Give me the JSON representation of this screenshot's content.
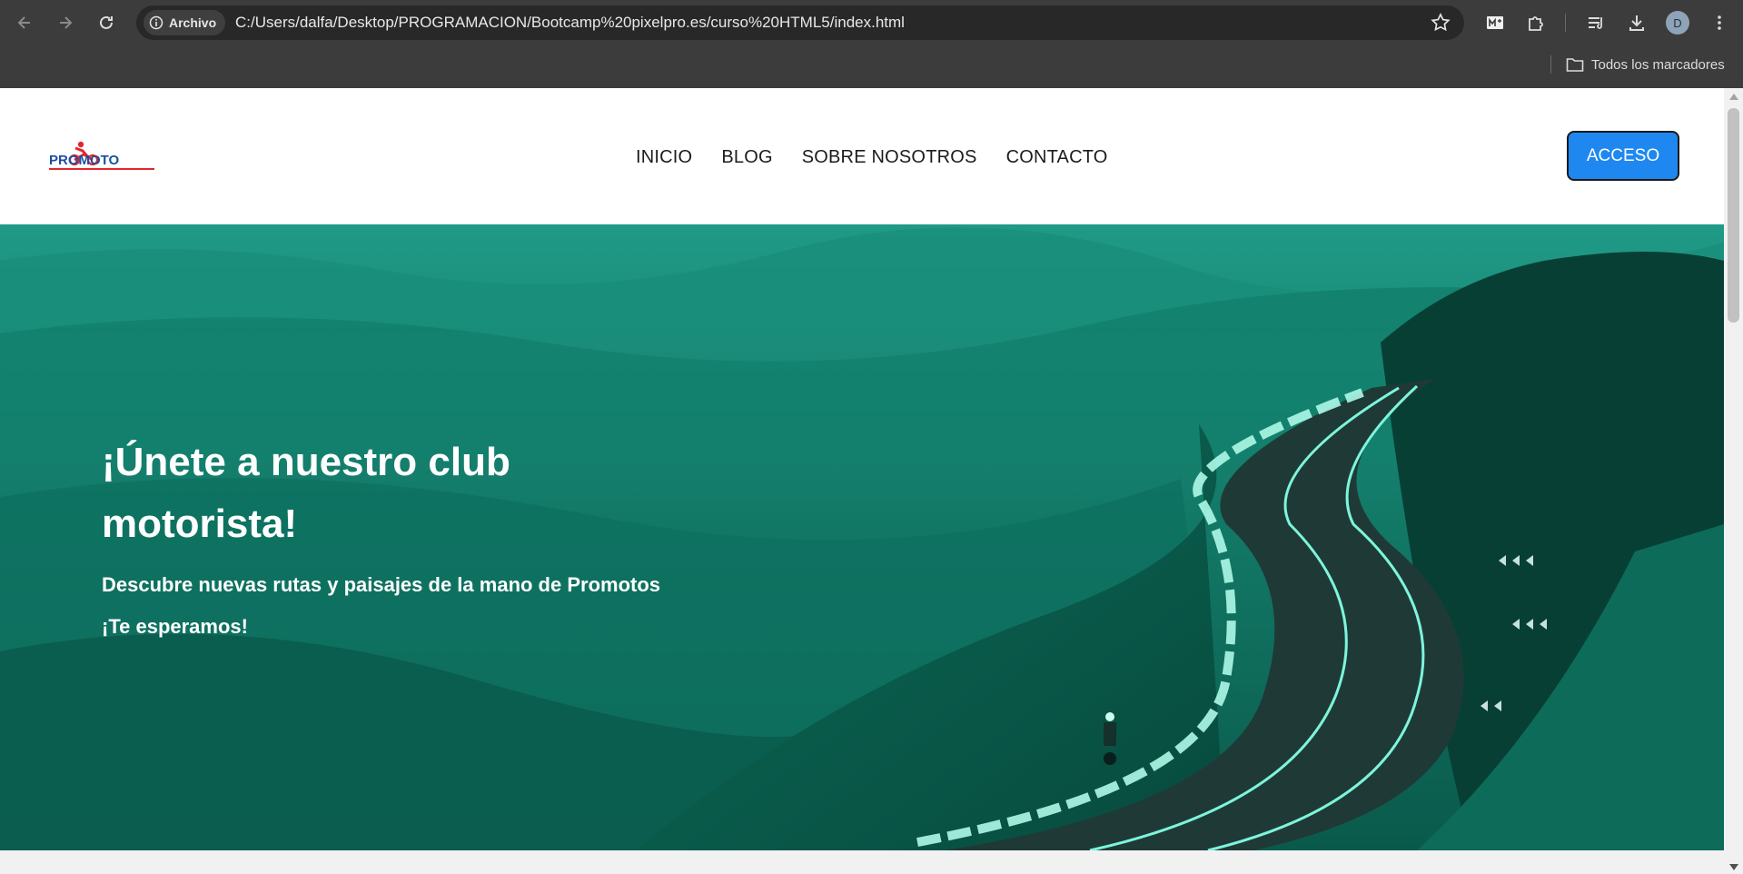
{
  "browser": {
    "site_chip_label": "Archivo",
    "url": "C:/Users/dalfa/Desktop/PROGRAMACION/Bootcamp%20pixelpro.es/curso%20HTML5/index.html",
    "avatar_initial": "D",
    "bookmarks_folder_label": "Todos los marcadores",
    "icons": [
      "back-arrow-icon",
      "forward-arrow-icon",
      "reload-icon",
      "info-icon",
      "star-icon",
      "media-icon",
      "extensions-icon",
      "reading-list-icon",
      "download-icon",
      "menu-kebab-icon",
      "folder-icon"
    ]
  },
  "site": {
    "logo_text": "PROMOTO",
    "nav": [
      {
        "label": "INICIO"
      },
      {
        "label": "BLOG"
      },
      {
        "label": "SOBRE NOSOTROS"
      },
      {
        "label": "CONTACTO"
      }
    ],
    "access_button": "ACCESO",
    "hero": {
      "title": "¡Únete a nuestro club motorista!",
      "subtitle": "Descubre nuevas rutas y paisajes de la mano de Promotos",
      "cta_text": "¡Te esperamos!"
    }
  },
  "colors": {
    "chrome_bg": "#3c3c3c",
    "omnibox_bg": "#282828",
    "access_button_bg": "#1e88f0",
    "hero_tint": "#0f7d6a",
    "logo_red": "#e3262d",
    "logo_blue": "#1d4fa0"
  }
}
